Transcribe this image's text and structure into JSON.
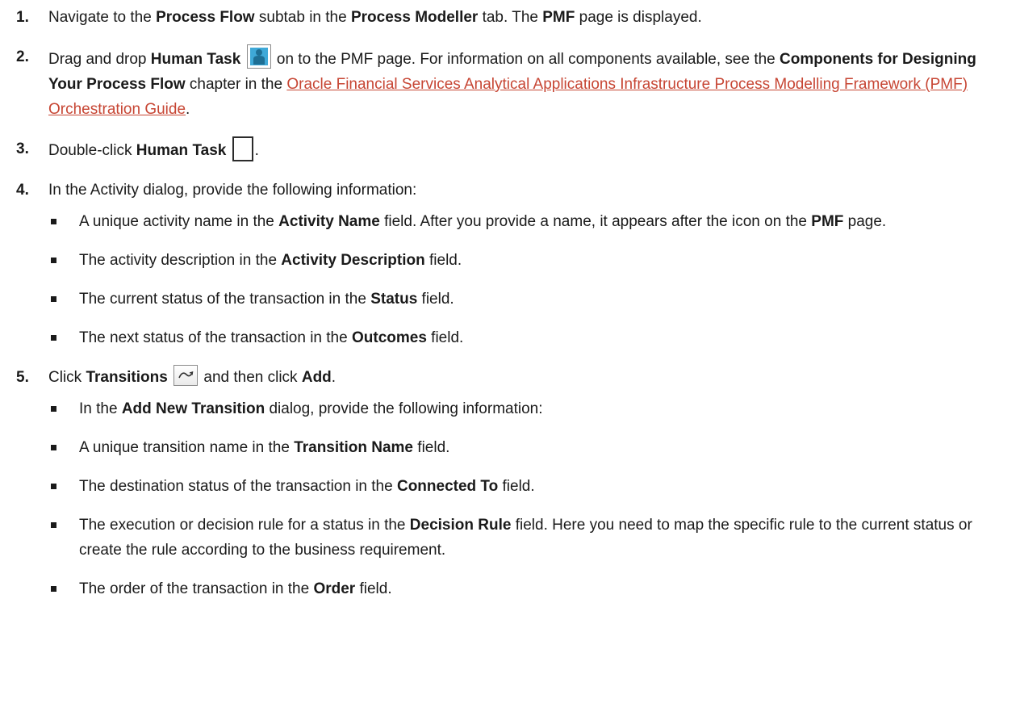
{
  "steps": [
    {
      "num": "1.",
      "t1": "Navigate to the ",
      "b1": "Process Flow",
      "t2": " subtab in the ",
      "b2": "Process Modeller",
      "t3": " tab. The ",
      "b3": "PMF",
      "t4": " page is displayed."
    },
    {
      "num": "2.",
      "t1": "Drag and drop ",
      "b1": "Human Task",
      "icon": "human-task-icon",
      "t2": " on to the PMF page. For information on all components available, see the ",
      "b2": "Components for Designing Your Process Flow",
      "t3": " chapter in the ",
      "link": "Oracle Financial Services Analytical Applications Infrastructure Process Modelling Framework (PMF) Orchestration Guide",
      "t4": "."
    },
    {
      "num": "3.",
      "t1": "Double-click ",
      "b1": "Human Task",
      "icon": "empty-box-icon",
      "t2": "."
    },
    {
      "num": "4.",
      "t1": "In the Activity dialog, provide the following information:",
      "bullets": [
        {
          "t1": "A unique activity name in the ",
          "b1": "Activity Name",
          "t2": " field. After you provide a name, it appears after the icon on the ",
          "b2": "PMF",
          "t3": " page."
        },
        {
          "t1": "The activity description in the ",
          "b1": "Activity Description",
          "t2": " field."
        },
        {
          "t1": "The current status of the transaction in the ",
          "b1": "Status",
          "t2": " field."
        },
        {
          "t1": "The next status of the transaction in the ",
          "b1": "Outcomes",
          "t2": " field."
        }
      ]
    },
    {
      "num": "5.",
      "t1": "Click ",
      "b1": "Transitions",
      "icon": "transitions-icon",
      "t2": " and then click ",
      "b2": "Add",
      "t3": ".",
      "bullets": [
        {
          "t1": "In the ",
          "b1": "Add New Transition",
          "t2": " dialog, provide the following information:"
        },
        {
          "t1": "A unique transition name in the ",
          "b1": "Transition Name",
          "t2": " field."
        },
        {
          "t1": "The destination status of the transaction in the ",
          "b1": "Connected To",
          "t2": " field."
        },
        {
          "t1": "The execution or decision rule for a status in the ",
          "b1": "Decision Rule",
          "t2": " field. Here you need to map the specific rule to the current status or create the rule according to the business requirement."
        },
        {
          "t1": "The order of the transaction in the ",
          "b1": "Order",
          "t2": " field."
        }
      ]
    }
  ],
  "colors": {
    "link": "#c74634",
    "text": "#1a1a1a",
    "human_icon_fill": "#3fa9d8"
  }
}
